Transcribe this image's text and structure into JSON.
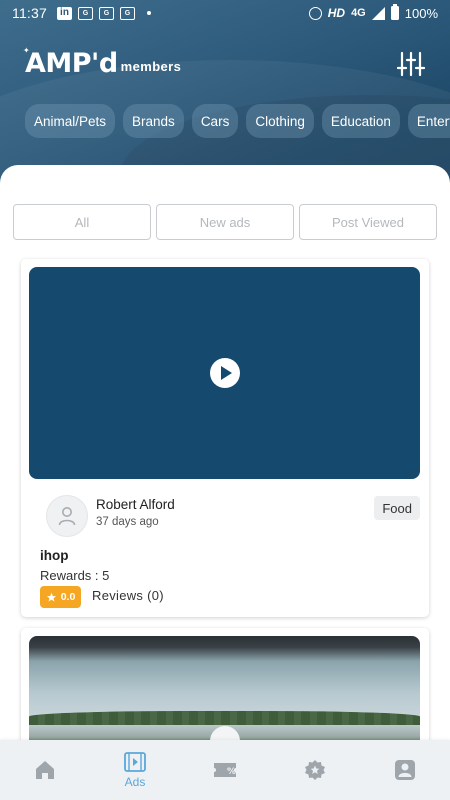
{
  "status_bar": {
    "time": "11:37",
    "network_hd": "HD",
    "network_type": "4G",
    "battery": "100%"
  },
  "header": {
    "logo_main": "AMP'd",
    "logo_suffix": "members"
  },
  "categories": [
    "Animal/Pets",
    "Brands",
    "Cars",
    "Clothing",
    "Education",
    "Entertain"
  ],
  "tabs": [
    "All",
    "New ads",
    "Post Viewed"
  ],
  "ads": [
    {
      "author": "Robert Alford",
      "posted": "37 days ago",
      "category": "Food",
      "title": "ihop",
      "rewards": "Rewards : 5",
      "rating": "0.0",
      "reviews": "Reviews (0)"
    }
  ],
  "bottom_nav": {
    "ads_label": "Ads",
    "active_color": "#5aa7d9",
    "inactive_color": "#9ea5ab"
  },
  "colors": {
    "header": "#2f5c7d",
    "video_placeholder": "#154a6e",
    "rating_badge": "#f5a623"
  }
}
